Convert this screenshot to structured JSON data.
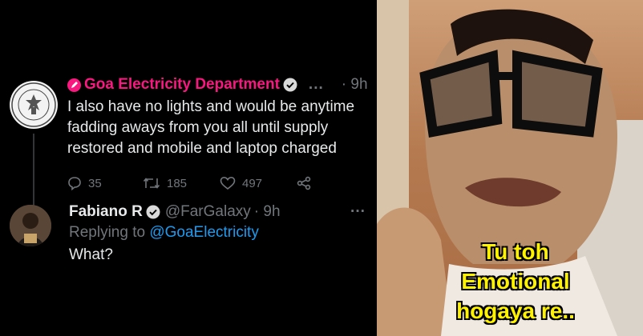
{
  "tweet": {
    "author_name": "Goa Electricity Department",
    "time": "9h",
    "more": "...",
    "lines": [
      "I also have no lights and would be anytime",
      "fadding aways from you all until supply",
      "restored and mobile and laptop charged"
    ],
    "reply_count": "35",
    "retweet_count": "185",
    "like_count": "497"
  },
  "reply": {
    "author_name": "Fabiano R",
    "handle": "@FarGalaxy",
    "time": "· 9h",
    "more": "···",
    "replying_label": "Replying to",
    "replying_to": "@GoaElectricity",
    "text": "What?"
  },
  "meme": {
    "caption_lines": [
      "Tu toh",
      "Emotional",
      "hogaya re.."
    ]
  },
  "colors": {
    "brand_pink": "#f91880",
    "link_blue": "#1d9bf0",
    "muted": "#71767b",
    "caption_yellow": "#fff200"
  }
}
